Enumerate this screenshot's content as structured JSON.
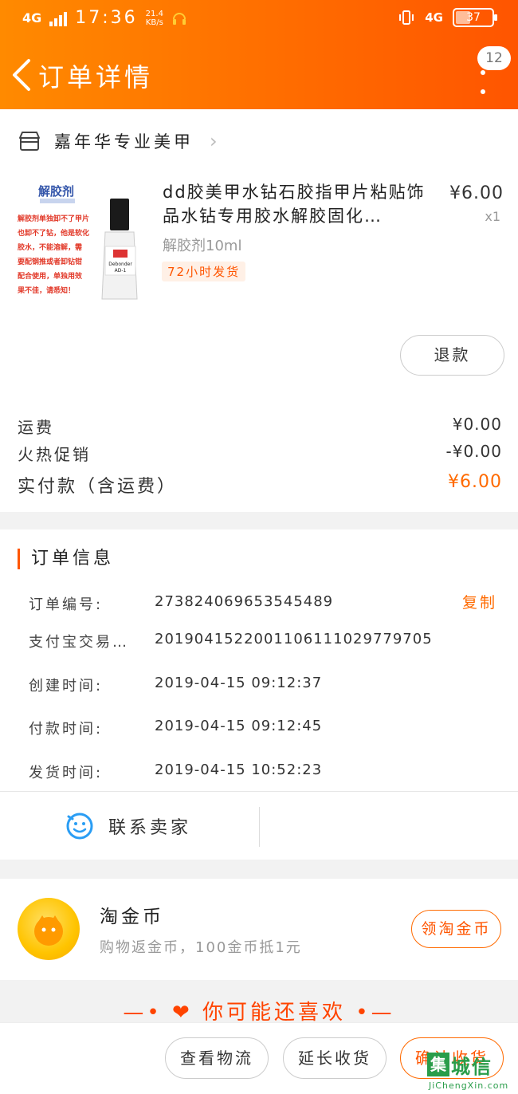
{
  "status_bar": {
    "network": "4G",
    "time": "17:36",
    "speed_value": "21.4",
    "speed_unit": "KB/s",
    "network_right": "4G",
    "battery": "37"
  },
  "header": {
    "title": "订单详情",
    "badge_count": "12"
  },
  "shop": {
    "name": "嘉年华专业美甲"
  },
  "product": {
    "name": "dd胶美甲水钻石胶指甲片粘贴饰品水钻专用胶水解胶固化…",
    "price": "¥6.00",
    "quantity": "x1",
    "sku": "解胶剂10ml",
    "tag": "72小时发货",
    "image": {
      "title": "解胶剂",
      "lines": [
        "解胶剂单独卸不了甲片",
        "也卸不了钻，他是软化",
        "胶水，不能溶解，需",
        "要配钢推或者卸钻钳",
        "配合使用，单独用效",
        "果不佳，请悉知！"
      ],
      "bottle_label_1": "Debonder",
      "bottle_label_2": "AD-1"
    },
    "refund_label": "退款"
  },
  "fees": [
    {
      "label": "运费",
      "value": "¥0.00"
    },
    {
      "label": "火热促销",
      "value": "-¥0.00"
    }
  ],
  "payment": {
    "label": "实付款（含运费）",
    "value": "¥6.00"
  },
  "order_info": {
    "title": "订单信息",
    "copy_label": "复制",
    "rows": [
      {
        "label": "订单编号:",
        "value": "273824069653545489"
      },
      {
        "label": "支付宝交易…",
        "value": "2019041522001106111029779705"
      },
      {
        "label": "创建时间:",
        "value": "2019-04-15 09:12:37"
      },
      {
        "label": "付款时间:",
        "value": "2019-04-15 09:12:45"
      },
      {
        "label": "发货时间:",
        "value": "2019-04-15 10:52:23"
      }
    ]
  },
  "contact": {
    "label": "联系卖家"
  },
  "coins": {
    "title": "淘金币",
    "subtitle": "购物返金币，100金币抵1元",
    "button": "领淘金币"
  },
  "recommend": {
    "label": "你可能还喜欢"
  },
  "bottom_bar": {
    "logistics": "查看物流",
    "extend": "延长收货",
    "confirm": "确认收货"
  },
  "watermark": {
    "text": "城信",
    "box": "集",
    "sub": "JiChengXin.com"
  },
  "colors": {
    "accent": "#ff5500",
    "header_start": "#ff8a00",
    "header_end": "#ff5500"
  }
}
